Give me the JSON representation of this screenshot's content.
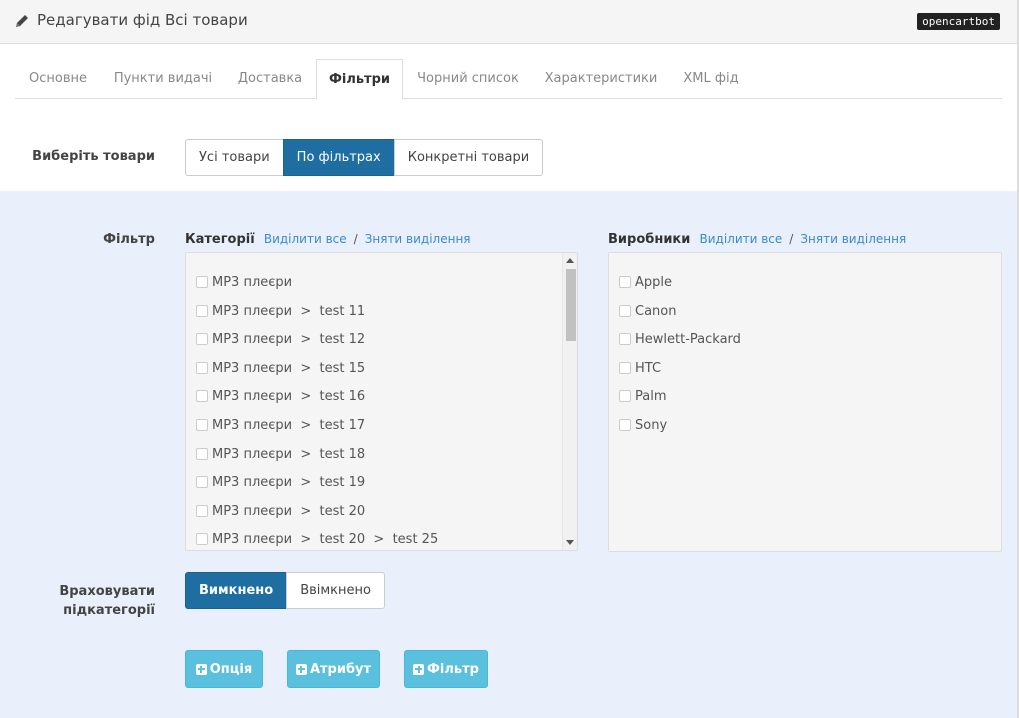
{
  "header": {
    "title": "Редагувати фід Всі товари",
    "badge": "opencartbot",
    "icon": "pencil-icon"
  },
  "tabs": [
    {
      "label": "Основне",
      "active": false
    },
    {
      "label": "Пункти видачі",
      "active": false
    },
    {
      "label": "Доставка",
      "active": false
    },
    {
      "label": "Фільтри",
      "active": true
    },
    {
      "label": "Чорний список",
      "active": false
    },
    {
      "label": "Характеристики",
      "active": false
    },
    {
      "label": "XML фід",
      "active": false
    }
  ],
  "select_products": {
    "label": "Виберіть товари",
    "options": [
      "Усі товари",
      "По фільтрах",
      "Конкретні товари"
    ],
    "selected": "По фільтрах"
  },
  "filter": {
    "label": "Фільтр",
    "categories": {
      "title": "Категорії",
      "select_all": "Виділити все",
      "separator": "/",
      "deselect": "Зняти виділення",
      "items": [
        "MP3 плеєри",
        "MP3 плеєри  >  test 11",
        "MP3 плеєри  >  test 12",
        "MP3 плеєри  >  test 15",
        "MP3 плеєри  >  test 16",
        "MP3 плеєри  >  test 17",
        "MP3 плеєри  >  test 18",
        "MP3 плеєри  >  test 19",
        "MP3 плеєри  >  test 20",
        "MP3 плеєри  >  test 20  >  test 25"
      ]
    },
    "manufacturers": {
      "title": "Виробники",
      "select_all": "Виділити все",
      "separator": "/",
      "deselect": "Зняти виділення",
      "items": [
        "Apple",
        "Canon",
        "Hewlett-Packard",
        "HTC",
        "Palm",
        "Sony"
      ]
    }
  },
  "subcategories": {
    "label_line1": "Враховувати",
    "label_line2": "підкатегорії",
    "options": [
      "Вимкнено",
      "Ввімкнено"
    ],
    "selected": "Вимкнено"
  },
  "add_buttons": {
    "option": "Опція",
    "attribute": "Атрибут",
    "filter": "Фільтр"
  },
  "colors": {
    "primary": "#1e6ea2",
    "info": "#5bc0de",
    "filter_bg": "#e9f0fb",
    "link": "#3b8ac4"
  }
}
